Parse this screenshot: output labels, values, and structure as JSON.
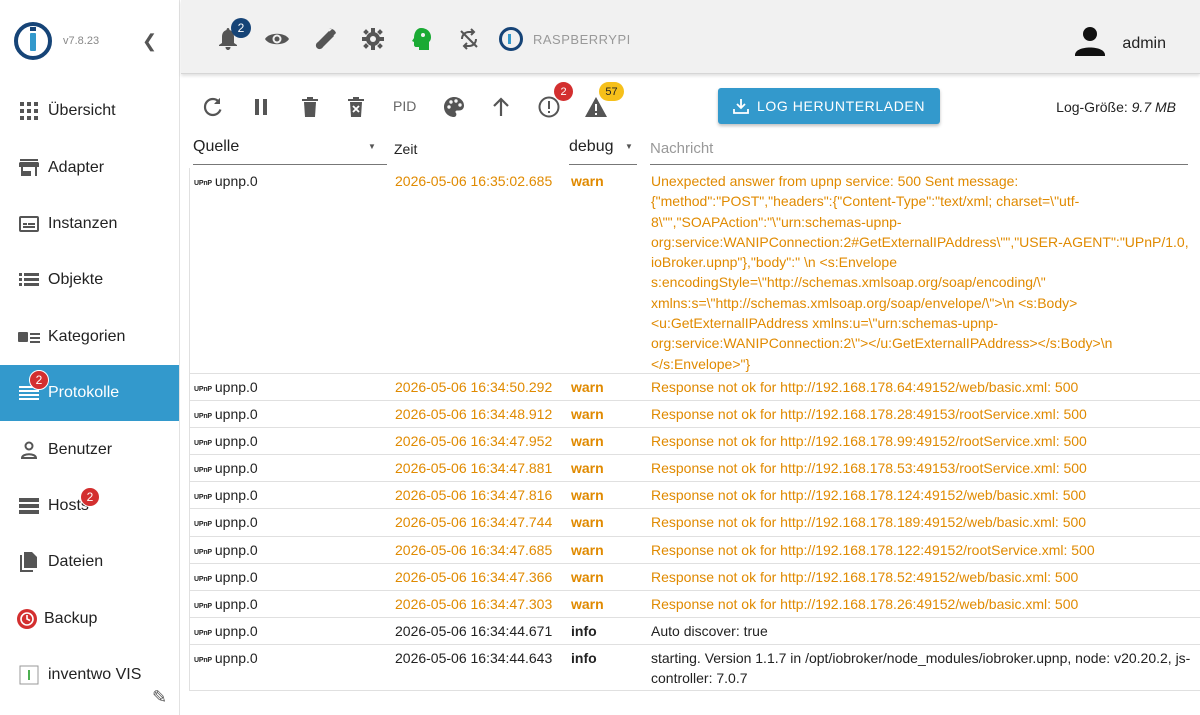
{
  "app": {
    "version": "v7.8.23"
  },
  "sidebar": {
    "items": [
      {
        "label": "Übersicht",
        "icon": "apps-grid-icon"
      },
      {
        "label": "Adapter",
        "icon": "store-icon"
      },
      {
        "label": "Instanzen",
        "icon": "instances-icon"
      },
      {
        "label": "Objekte",
        "icon": "list-icon"
      },
      {
        "label": "Kategorien",
        "icon": "categories-icon"
      },
      {
        "label": "Protokolle",
        "icon": "log-lines-icon",
        "badge": "2",
        "active": true
      },
      {
        "label": "Benutzer",
        "icon": "person-icon"
      },
      {
        "label": "Hosts",
        "icon": "storage-icon",
        "badge": "2"
      },
      {
        "label": "Dateien",
        "icon": "file-copy-icon"
      },
      {
        "label": "Backup",
        "icon": "backup-clock-icon"
      },
      {
        "label": "inventwo VIS",
        "icon": "inventwo-icon"
      }
    ]
  },
  "topbar": {
    "notifications_badge": "2",
    "host_name": "RASPBERRYPI",
    "user_name": "admin"
  },
  "toolbar": {
    "pid_label": "PID",
    "error_count": "2",
    "warn_count": "57",
    "download_label": "LOG HERUNTERLADEN",
    "log_size_label": "Log-Größe:",
    "log_size_value": "9.7 MB"
  },
  "table": {
    "headers": {
      "source": "Quelle",
      "time": "Zeit",
      "severity": "debug",
      "message_placeholder": "Nachricht"
    },
    "rows": [
      {
        "source": "upnp.0",
        "time": "2026-05-06 16:35:02.685",
        "severity": "warn",
        "message": "Unexpected answer from upnp service: 500 Sent message: {\"method\":\"POST\",\"headers\":{\"Content-Type\":\"text/xml; charset=\\\"utf-8\\\"\",\"SOAPAction\":\"\\\"urn:schemas-upnp-org:service:WANIPConnection:2#GetExternalIPAddress\\\"\",\"USER-AGENT\":\"UPnP/1.0, ioBroker.upnp\"},\"body\":\" \\n <s:Envelope s:encodingStyle=\\\"http://schemas.xmlsoap.org/soap/encoding/\\\" xmlns:s=\\\"http://schemas.xmlsoap.org/soap/envelope/\\\">\\n <s:Body> <u:GetExternalIPAddress xmlns:u=\\\"urn:schemas-upnp-org:service:WANIPConnection:2\\\"></u:GetExternalIPAddress></s:Body>\\n </s:Envelope>\"}"
      },
      {
        "source": "upnp.0",
        "time": "2026-05-06 16:34:50.292",
        "severity": "warn",
        "message": "Response not ok for http://192.168.178.64:49152/web/basic.xml: 500"
      },
      {
        "source": "upnp.0",
        "time": "2026-05-06 16:34:48.912",
        "severity": "warn",
        "message": "Response not ok for http://192.168.178.28:49153/rootService.xml: 500"
      },
      {
        "source": "upnp.0",
        "time": "2026-05-06 16:34:47.952",
        "severity": "warn",
        "message": "Response not ok for http://192.168.178.99:49152/rootService.xml: 500"
      },
      {
        "source": "upnp.0",
        "time": "2026-05-06 16:34:47.881",
        "severity": "warn",
        "message": "Response not ok for http://192.168.178.53:49153/rootService.xml: 500"
      },
      {
        "source": "upnp.0",
        "time": "2026-05-06 16:34:47.816",
        "severity": "warn",
        "message": "Response not ok for http://192.168.178.124:49152/web/basic.xml: 500"
      },
      {
        "source": "upnp.0",
        "time": "2026-05-06 16:34:47.744",
        "severity": "warn",
        "message": "Response not ok for http://192.168.178.189:49152/web/basic.xml: 500"
      },
      {
        "source": "upnp.0",
        "time": "2026-05-06 16:34:47.685",
        "severity": "warn",
        "message": "Response not ok for http://192.168.178.122:49152/rootService.xml: 500"
      },
      {
        "source": "upnp.0",
        "time": "2026-05-06 16:34:47.366",
        "severity": "warn",
        "message": "Response not ok for http://192.168.178.52:49152/web/basic.xml: 500"
      },
      {
        "source": "upnp.0",
        "time": "2026-05-06 16:34:47.303",
        "severity": "warn",
        "message": "Response not ok for http://192.168.178.26:49152/web/basic.xml: 500"
      },
      {
        "source": "upnp.0",
        "time": "2026-05-06 16:34:44.671",
        "severity": "info",
        "message": "Auto discover: true"
      },
      {
        "source": "upnp.0",
        "time": "2026-05-06 16:34:44.643",
        "severity": "info",
        "message": "starting. Version 1.1.7 in /opt/iobroker/node_modules/iobroker.upnp, node: v20.20.2, js-controller: 7.0.7"
      }
    ]
  },
  "colors": {
    "accent": "#3399cc",
    "brand": "#164477",
    "warn": "#e08a00",
    "badge_red": "#d32f2f",
    "badge_yellow": "#f6c01a"
  }
}
